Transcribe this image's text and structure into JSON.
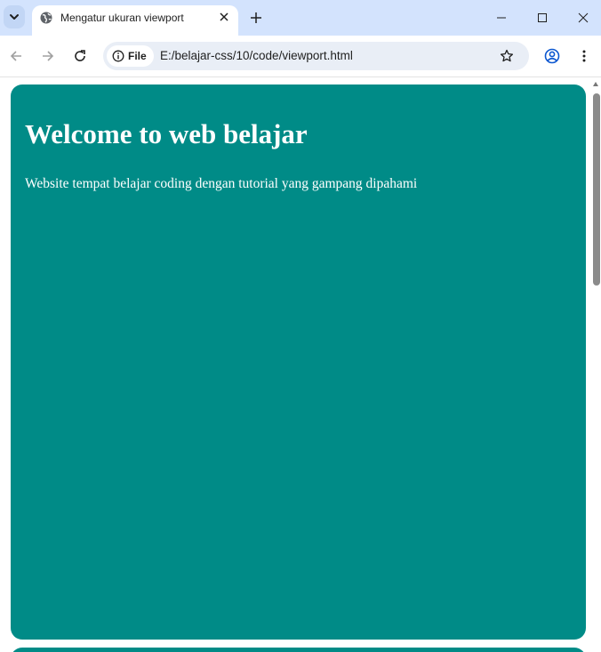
{
  "browser": {
    "tab": {
      "title": "Mengatur ukuran viewport",
      "favicon": "globe-icon"
    },
    "address_bar": {
      "security_label": "File",
      "url": "E:/belajar-css/10/code/viewport.html"
    },
    "icons": [
      "tab-search-icon",
      "globe-icon",
      "close-icon",
      "plus-icon",
      "minimize-icon",
      "maximize-icon",
      "close-window-icon",
      "back-arrow-icon",
      "forward-arrow-icon",
      "reload-icon",
      "info-icon",
      "star-icon",
      "profile-icon",
      "kebab-menu-icon"
    ]
  },
  "page": {
    "heading": "Welcome to web belajar",
    "description": "Website tempat belajar coding dengan tutorial yang gampang dipahami",
    "card_color": "#008b87"
  },
  "colors": {
    "titlebar": "#d3e3fd",
    "omnibox": "#e9eef6",
    "text_on_card": "#ffffff"
  }
}
